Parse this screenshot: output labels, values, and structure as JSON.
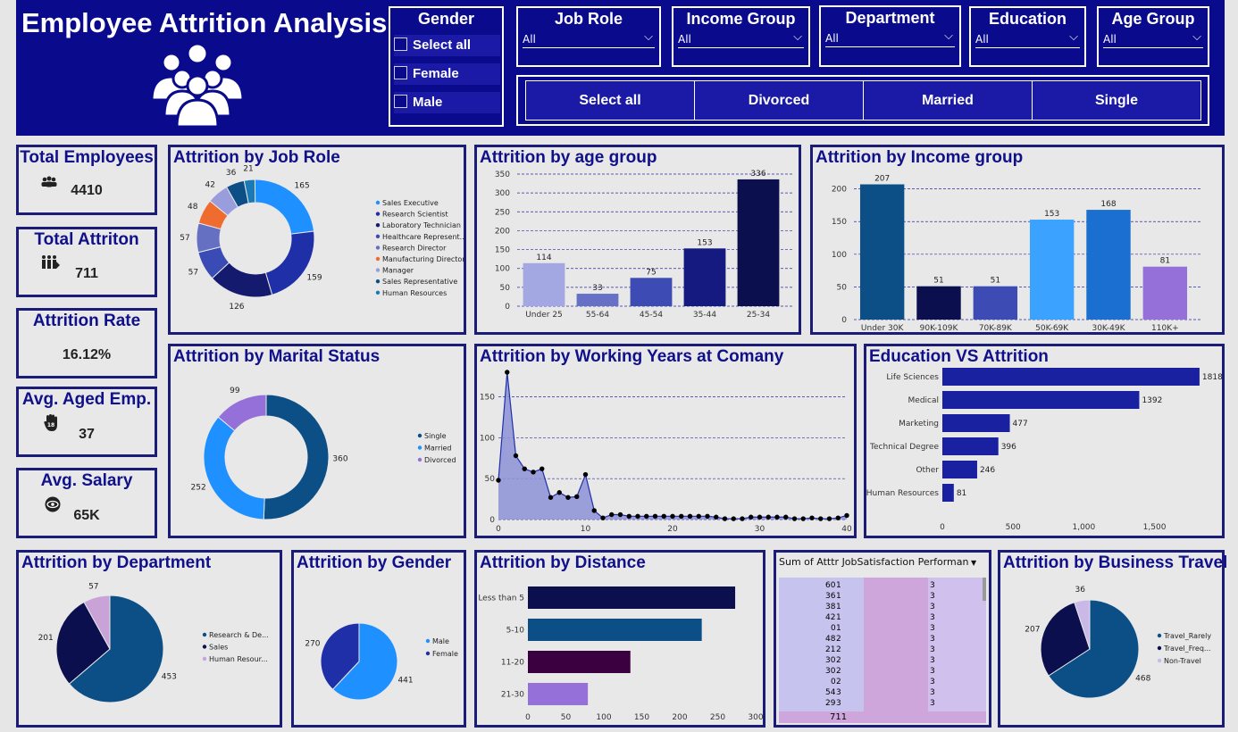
{
  "header": {
    "title": "Employee Attrition Analysis",
    "slicers": {
      "gender": {
        "label": "Gender",
        "items": [
          "Select all",
          "Female",
          "Male"
        ]
      },
      "job_role": {
        "label": "Job Role",
        "value": "All"
      },
      "income_group": {
        "label": "Income Group",
        "value": "All"
      },
      "department": {
        "label": "Department",
        "value": "All"
      },
      "education": {
        "label": "Education",
        "value": "All"
      },
      "age_group": {
        "label": "Age Group",
        "value": "All"
      },
      "marital": [
        "Select all",
        "Divorced",
        "Married",
        "Single"
      ]
    }
  },
  "kpis": [
    {
      "label": "Total Employees",
      "value": "4410",
      "icon": "people-icon"
    },
    {
      "label": "Total Attriton",
      "value": "711",
      "icon": "walkout-icon"
    },
    {
      "label": "Attrition Rate",
      "value": "16.12%",
      "icon": ""
    },
    {
      "label": "Avg. Aged Emp.",
      "value": "37",
      "icon": "age-hand-icon"
    },
    {
      "label": "Avg. Salary",
      "value": "65K",
      "icon": "money-icon"
    }
  ],
  "titles": {
    "job_role": "Attrition by Job Role",
    "age": "Attrition by age group",
    "income": "Attrition by Income group",
    "marital": "Attrition by Marital Status",
    "years": "Attrition by Working Years at Comany",
    "education": "Education VS Attrition",
    "department": "Attrition by Department",
    "gender": "Attrition by Gender",
    "distance": "Attrition by Distance",
    "travel": "Attrition by Business Travel"
  },
  "table": {
    "headers": [
      "Sum of Atttr",
      "JobSatisfaction",
      "Performan"
    ],
    "rows": [
      [
        "60",
        "1",
        "3"
      ],
      [
        "36",
        "1",
        "3"
      ],
      [
        "38",
        "1",
        "3"
      ],
      [
        "42",
        "1",
        "3"
      ],
      [
        "0",
        "1",
        "3"
      ],
      [
        "48",
        "2",
        "3"
      ],
      [
        "21",
        "2",
        "3"
      ],
      [
        "30",
        "2",
        "3"
      ],
      [
        "30",
        "2",
        "3"
      ],
      [
        "0",
        "2",
        "3"
      ],
      [
        "54",
        "3",
        "3"
      ],
      [
        "29",
        "3",
        "3"
      ]
    ],
    "total": "711"
  },
  "chart_data": [
    {
      "id": "job_role",
      "type": "pie",
      "donut": true,
      "categories": [
        "Sales Executive",
        "Research Scientist",
        "Laboratory Technician",
        "Healthcare Represent...",
        "Research Director",
        "Manufacturing Director",
        "Manager",
        "Sales Representative",
        "Human Resources"
      ],
      "values": [
        165,
        159,
        126,
        57,
        57,
        48,
        42,
        36,
        21
      ],
      "colors": [
        "#1e90ff",
        "#1f2fa8",
        "#141a6e",
        "#3b4bb5",
        "#6670c2",
        "#ef6b2e",
        "#9a9ddc",
        "#0c4f86",
        "#1a7ab5"
      ],
      "legend": "right"
    },
    {
      "id": "age",
      "type": "bar",
      "categories": [
        "Under 25",
        "55-64",
        "45-54",
        "35-44",
        "25-34"
      ],
      "values": [
        114,
        33,
        75,
        153,
        336
      ],
      "colors": [
        "#a4a8e2",
        "#6670c6",
        "#3d4bb5",
        "#141a80",
        "#0b0f4e"
      ],
      "ylim": [
        0,
        350
      ],
      "yticks": [
        0,
        50,
        100,
        150,
        200,
        250,
        300,
        350
      ]
    },
    {
      "id": "income",
      "type": "bar",
      "categories": [
        "Under 30K",
        "90K-109K",
        "70K-89K",
        "50K-69K",
        "30K-49K",
        "110K+"
      ],
      "values": [
        207,
        51,
        51,
        153,
        168,
        81
      ],
      "colors": [
        "#0b4f86",
        "#0b0f4e",
        "#3d4bb5",
        "#3ba3ff",
        "#1a6fd1",
        "#9470d8"
      ],
      "ylim": [
        0,
        220
      ],
      "yticks": [
        0,
        50,
        100,
        150,
        200
      ]
    },
    {
      "id": "marital",
      "type": "pie",
      "donut": true,
      "categories": [
        "Single",
        "Married",
        "Divorced"
      ],
      "values": [
        360,
        252,
        99
      ],
      "colors": [
        "#0b4f86",
        "#1e90ff",
        "#9470d8"
      ],
      "legend": "right"
    },
    {
      "id": "years",
      "type": "area",
      "x": [
        0,
        1,
        2,
        3,
        4,
        5,
        6,
        7,
        8,
        9,
        10,
        11,
        12,
        13,
        14,
        15,
        16,
        17,
        18,
        19,
        20,
        21,
        22,
        23,
        24,
        25,
        26,
        27,
        28,
        29,
        30,
        31,
        32,
        33,
        34,
        35,
        36,
        37,
        38,
        39,
        40
      ],
      "values": [
        48,
        180,
        78,
        62,
        58,
        62,
        27,
        33,
        27,
        28,
        55,
        11,
        2,
        6,
        6,
        4,
        4,
        4,
        4,
        4,
        4,
        4,
        4,
        4,
        4,
        3,
        1,
        1,
        1,
        3,
        3,
        3,
        3,
        3,
        1,
        1,
        2,
        1,
        1,
        2,
        5
      ],
      "color": "#1f2fa8",
      "ylim": [
        0,
        180
      ],
      "yticks": [
        0,
        50,
        100,
        150
      ],
      "xticks": [
        0,
        10,
        20,
        30,
        40
      ]
    },
    {
      "id": "education",
      "type": "bar",
      "orientation": "horizontal",
      "categories": [
        "Life Sciences",
        "Medical",
        "Marketing",
        "Technical Degree",
        "Other",
        "Human Resources"
      ],
      "values": [
        1818,
        1392,
        477,
        396,
        246,
        81
      ],
      "color": "#1a21a0",
      "xlim": [
        0,
        1850
      ],
      "xticks": [
        0,
        500,
        1000,
        1500
      ],
      "xticklabels": [
        "0",
        "500",
        "1,000",
        "1,500"
      ]
    },
    {
      "id": "department",
      "type": "pie",
      "categories": [
        "Research & De...",
        "Sales",
        "Human Resour..."
      ],
      "values": [
        453,
        201,
        57
      ],
      "colors": [
        "#0b4f86",
        "#0b0f4e",
        "#c9a2d8"
      ],
      "legend": "right"
    },
    {
      "id": "gender",
      "type": "pie",
      "categories": [
        "Male",
        "Female"
      ],
      "values": [
        441,
        270
      ],
      "colors": [
        "#1e90ff",
        "#1f2fa8"
      ],
      "legend": "right"
    },
    {
      "id": "distance",
      "type": "bar",
      "orientation": "horizontal",
      "categories": [
        "Less than 5",
        "5-10",
        "11-20",
        "21-30"
      ],
      "values": [
        273,
        229,
        135,
        79
      ],
      "colors": [
        "#0b0f4e",
        "#0b4f86",
        "#3a0040",
        "#9470d8"
      ],
      "xlim": [
        0,
        300
      ],
      "xticks": [
        0,
        50,
        100,
        150,
        200,
        250,
        300
      ]
    },
    {
      "id": "travel",
      "type": "pie",
      "categories": [
        "Travel_Rarely",
        "Travel_Freq...",
        "Non-Travel"
      ],
      "values": [
        468,
        207,
        36
      ],
      "colors": [
        "#0b4f86",
        "#0b0f4e",
        "#c9b8e8"
      ],
      "legend": "right"
    }
  ]
}
